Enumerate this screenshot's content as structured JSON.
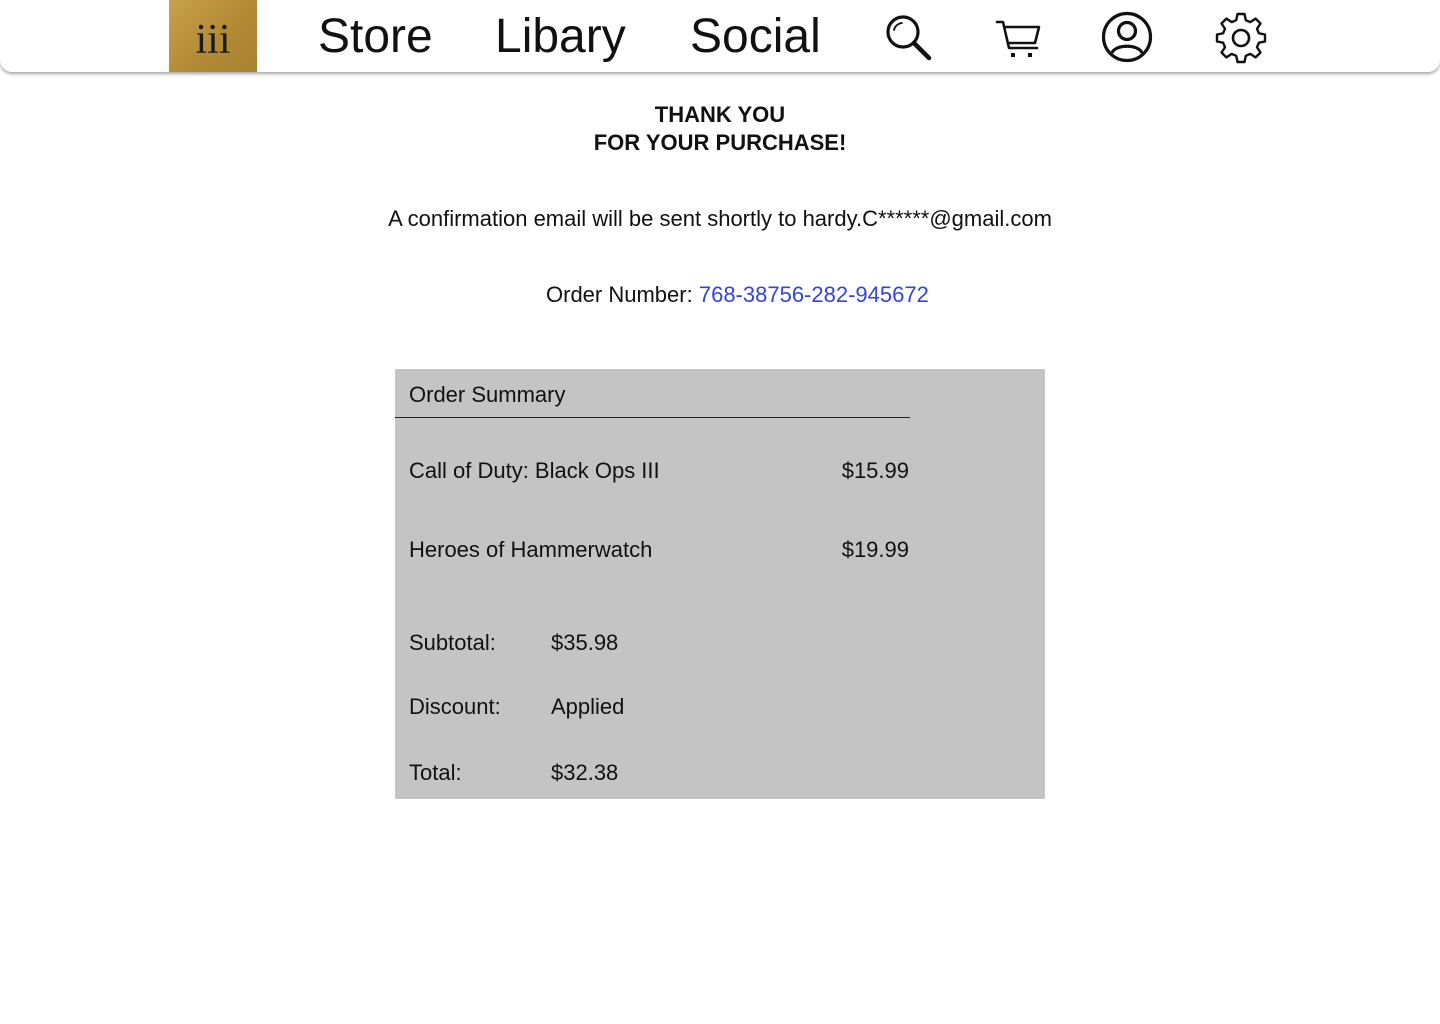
{
  "nav": {
    "logo_text": "iii",
    "links": [
      "Store",
      "Libary",
      "Social"
    ],
    "icons": [
      "search-icon",
      "cart-icon",
      "account-icon",
      "settings-icon"
    ],
    "logo_color": "#b38a35"
  },
  "confirmation": {
    "heading_line1": "THANK YOU",
    "heading_line2": "FOR YOUR PURCHASE!",
    "email_message": "A confirmation email will be sent shortly to hardy.C******@gmail.com",
    "order_number_label": "Order Number:",
    "order_number": "768-38756-282-945672",
    "order_number_color": "#3344dd"
  },
  "summary": {
    "title": "Order Summary",
    "items": [
      {
        "name": "Call of Duty: Black Ops III",
        "price": "$15.99"
      },
      {
        "name": "Heroes of Hammerwatch",
        "price": "$19.99"
      }
    ],
    "subtotal_label": "Subtotal:",
    "subtotal_value": "$35.98",
    "discount_label": "Discount:",
    "discount_value": "Applied",
    "total_label": "Total:",
    "total_value": "$32.38",
    "background_color": "#c4c4c4"
  }
}
